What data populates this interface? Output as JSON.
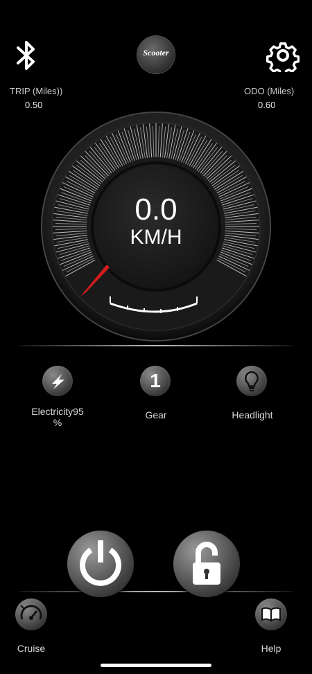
{
  "header": {
    "logo_text": "Scooter",
    "bluetooth_icon": "bluetooth-icon",
    "settings_icon": "gear-icon"
  },
  "trip": {
    "label": "TRIP (Miles))",
    "value": "0.50"
  },
  "odo": {
    "label": "ODO (Miles)",
    "value": "0.60"
  },
  "speedometer": {
    "speed": "0.0",
    "unit": "KM/H",
    "needle_fraction": 0.0
  },
  "status": {
    "electricity": {
      "label_line1": "Electricity95",
      "label_line2": "%",
      "icon": "lightning-icon"
    },
    "gear": {
      "label": "Gear",
      "value": "1"
    },
    "headlight": {
      "label": "Headlight",
      "icon": "bulb-icon"
    }
  },
  "controls": {
    "power_icon": "power-icon",
    "lock_icon": "unlock-icon"
  },
  "footer": {
    "cruise": {
      "label": "Cruise",
      "icon": "cruise-gauge-icon"
    },
    "help": {
      "label": "Help",
      "icon": "book-icon"
    }
  }
}
